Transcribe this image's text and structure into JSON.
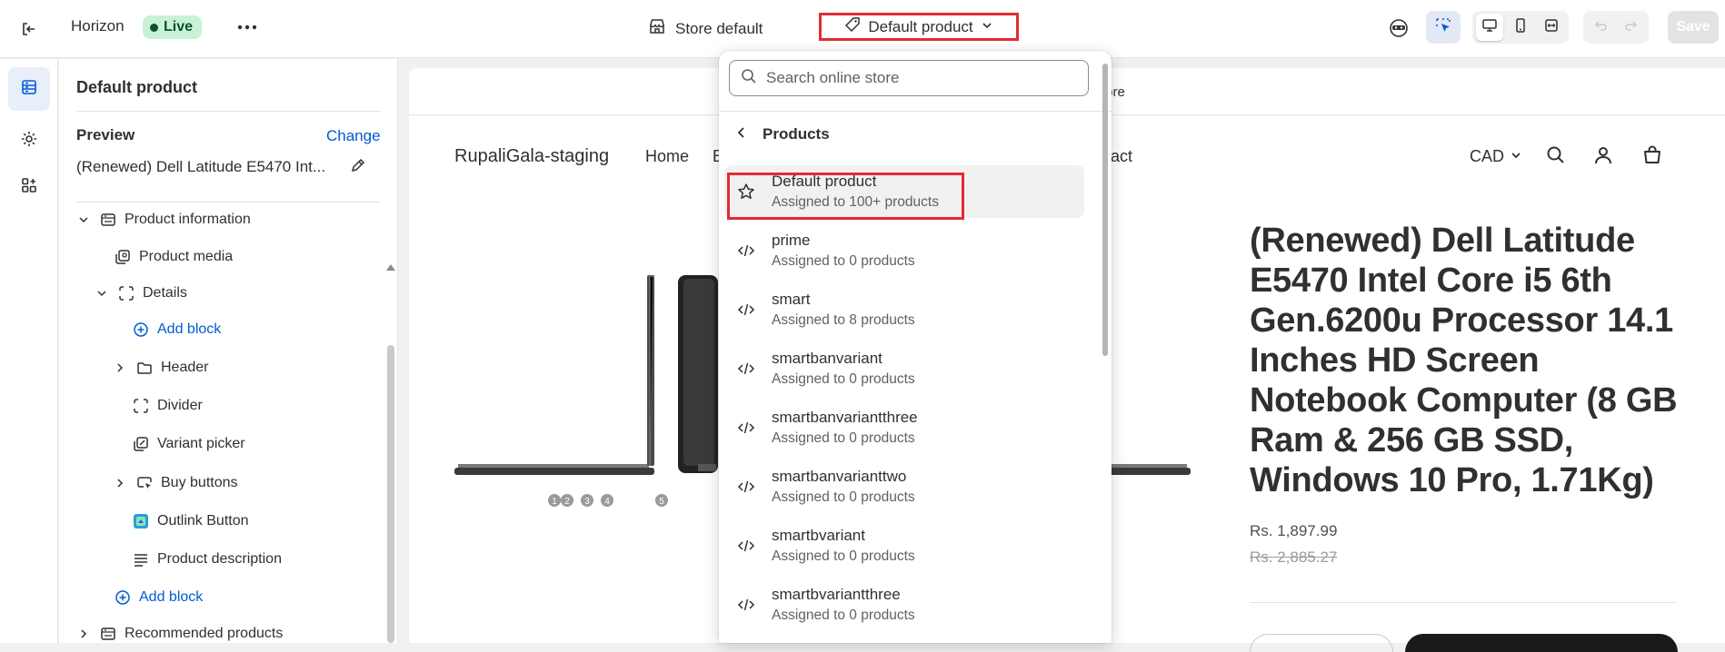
{
  "topbar": {
    "app_name": "Horizon",
    "status_badge": "Live",
    "store_label": "Store default",
    "template_selector": "Default product",
    "save_label": "Save"
  },
  "sidebar": {
    "title": "Default product",
    "preview_label": "Preview",
    "change_label": "Change",
    "preview_value": "(Renewed) Dell Latitude E5470 Int...",
    "tree": [
      {
        "label": "Product information"
      },
      {
        "label": "Product media"
      },
      {
        "label": "Details"
      },
      {
        "label": "Add block"
      },
      {
        "label": "Header"
      },
      {
        "label": "Divider"
      },
      {
        "label": "Variant picker"
      },
      {
        "label": "Buy buttons"
      },
      {
        "label": "Outlink Button"
      },
      {
        "label": "Product description"
      },
      {
        "label": "Add block"
      },
      {
        "label": "Recommended products"
      }
    ]
  },
  "dropdown": {
    "search_placeholder": "Search online store",
    "back_label": "Products",
    "items": [
      {
        "name": "Default product",
        "sub": "Assigned to 100+ products",
        "icon": "star-icon"
      },
      {
        "name": "prime",
        "sub": "Assigned to 0 products",
        "icon": "code-icon"
      },
      {
        "name": "smart",
        "sub": "Assigned to 8 products",
        "icon": "code-icon"
      },
      {
        "name": "smartbanvariant",
        "sub": "Assigned to 0 products",
        "icon": "code-icon"
      },
      {
        "name": "smartbanvariantthree",
        "sub": "Assigned to 0 products",
        "icon": "code-icon"
      },
      {
        "name": "smartbanvarianttwo",
        "sub": "Assigned to 0 products",
        "icon": "code-icon"
      },
      {
        "name": "smartbvariant",
        "sub": "Assigned to 0 products",
        "icon": "code-icon"
      },
      {
        "name": "smartbvariantthree",
        "sub": "Assigned to 0 products",
        "icon": "code-icon"
      }
    ]
  },
  "preview": {
    "announcement": "tore",
    "store_name": "RupaliGala-staging",
    "nav": [
      "Home",
      "E",
      "act"
    ],
    "currency": "CAD",
    "product_title": "(Renewed) Dell Latitude E5470 Intel Core i5 6th Gen.6200u Processor 14.1 Inches HD Screen Notebook Computer (8 GB Ram & 256 GB SSD, Windows 10 Pro, 1.71Kg)",
    "price": "Rs. 1,897.99",
    "compare_price": "Rs. 2,885.27",
    "port_labels": [
      "1",
      "2",
      "3",
      "4",
      "5"
    ]
  },
  "colors": {
    "accent": "#005bd3",
    "highlight": "#e32b33",
    "live_bg": "#c8f2d6",
    "live_text": "#0c5132"
  }
}
